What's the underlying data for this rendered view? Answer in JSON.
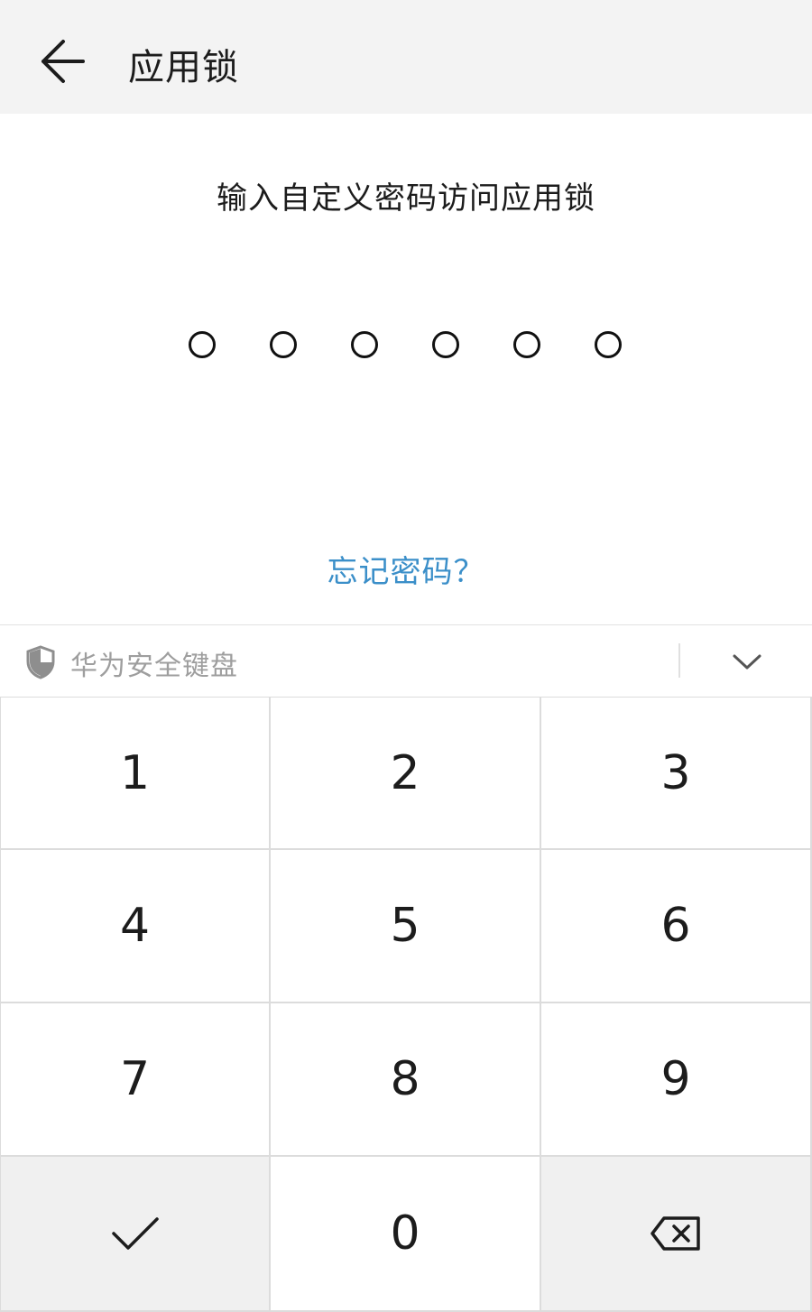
{
  "header": {
    "back_icon": "arrow-left-icon",
    "title": "应用锁"
  },
  "prompt": "输入自定义密码访问应用锁",
  "pin": {
    "length": 6,
    "entered": 0
  },
  "forgot_link": "忘记密码？",
  "keyboard": {
    "shield_icon": "shield-icon",
    "label": "华为安全键盘",
    "collapse_icon": "chevron-down-icon",
    "keys": [
      "1",
      "2",
      "3",
      "4",
      "5",
      "6",
      "7",
      "8",
      "9",
      "0"
    ],
    "confirm_icon": "checkmark-icon",
    "delete_icon": "backspace-icon"
  },
  "colors": {
    "header_bg": "#f3f3f3",
    "link": "#3b8fc9",
    "keypad_gray": "#f0f0f0",
    "text": "#1c1c1c"
  }
}
